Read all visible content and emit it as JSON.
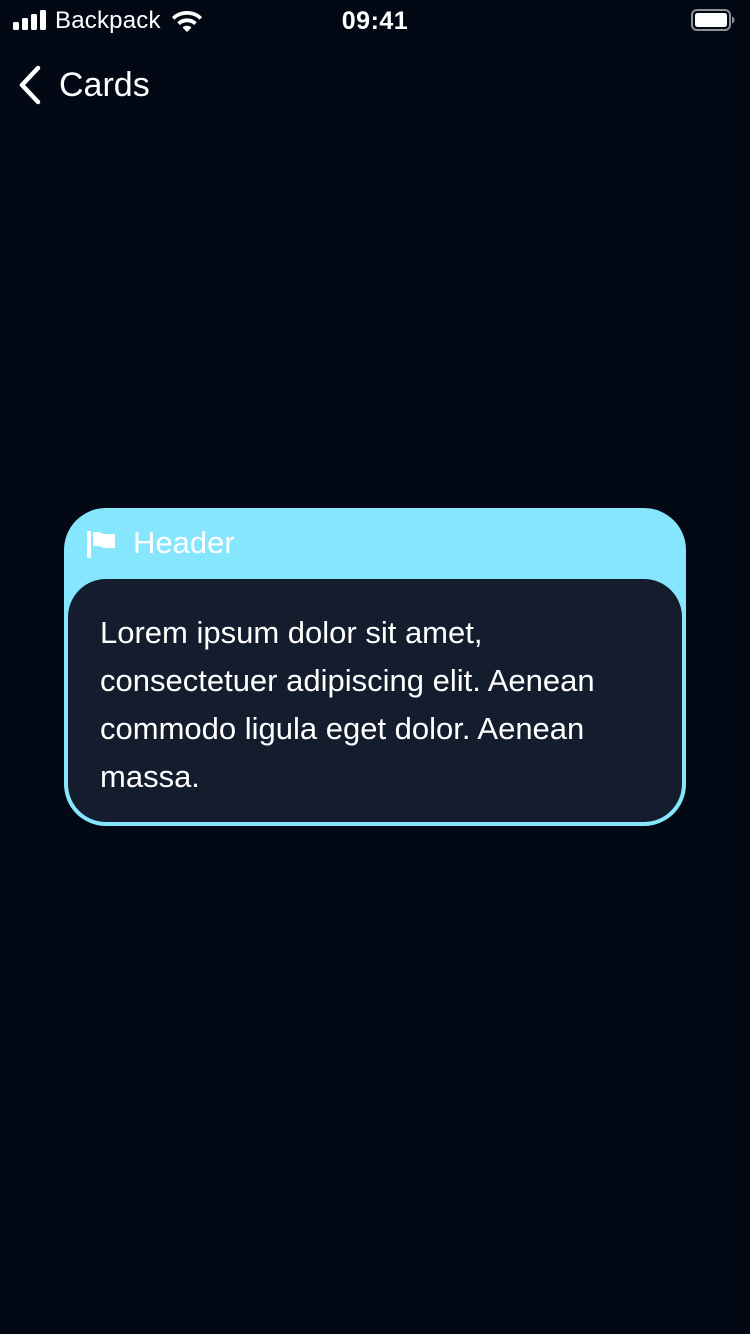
{
  "status_bar": {
    "carrier": "Backpack",
    "time": "09:41",
    "signal_icon": "cellular-signal-icon",
    "wifi_icon": "wifi-icon",
    "battery_icon": "battery-icon",
    "battery_level": 1.0
  },
  "nav": {
    "back_icon": "chevron-left-icon",
    "title": "Cards"
  },
  "card": {
    "header_icon": "flag-icon",
    "header_label": "Header",
    "body_text": "Lorem ipsum dolor sit amet, consectetuer adipiscing elit. Aenean commodo ligula eget dolor. Aenean massa.",
    "colors": {
      "header_background": "#86e6fd",
      "body_background": "#141d2d",
      "page_background": "#030914"
    }
  }
}
